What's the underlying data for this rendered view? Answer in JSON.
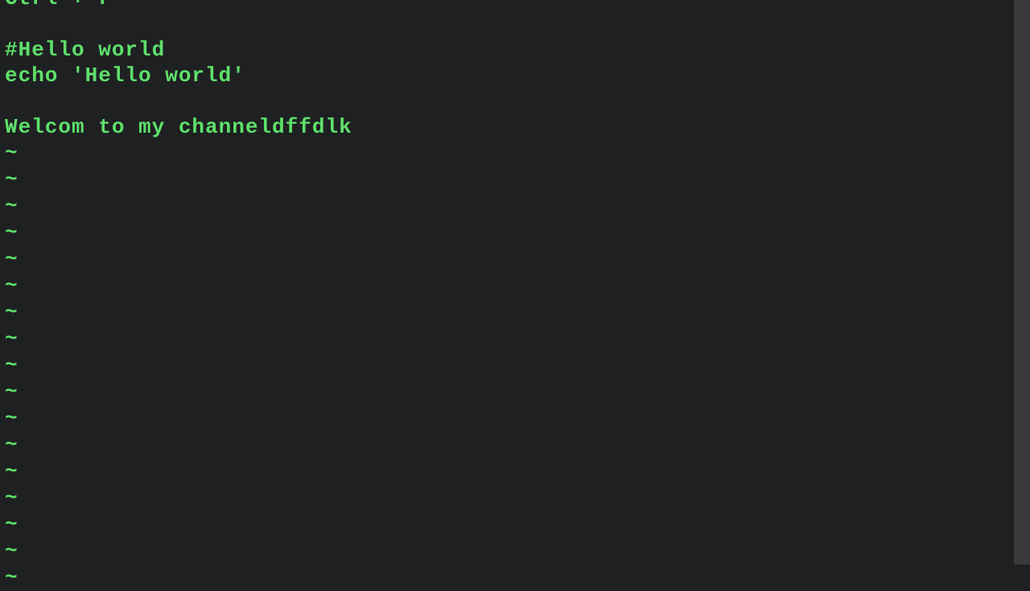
{
  "editor": {
    "lines": [
      "Ctrl + r",
      "",
      "#Hello world",
      "echo 'Hello world'",
      "",
      "Welcom to my channeldffdlk"
    ],
    "tilde": "~",
    "tilde_count": 17
  },
  "colors": {
    "background": "#1f2022",
    "text": "#5ee06a"
  }
}
